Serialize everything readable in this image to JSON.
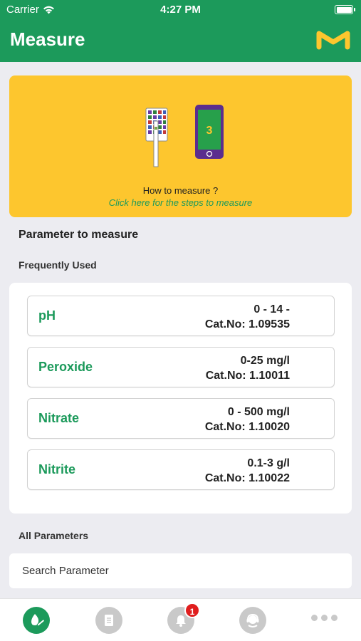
{
  "status_bar": {
    "carrier": "Carrier",
    "time": "4:27 PM"
  },
  "header": {
    "title": "Measure",
    "logo_icon": "merck-m-logo"
  },
  "banner": {
    "title": "How to measure ?",
    "link": "Click here for the steps to measure",
    "phone_number": "3",
    "background": "#fdc62e"
  },
  "section": {
    "title": "Parameter to measure",
    "frequently_used": "Frequently Used",
    "all_parameters": "All Parameters"
  },
  "frequent": [
    {
      "name": "pH",
      "range": "0 - 14 -",
      "cat": "Cat.No: 1.09535"
    },
    {
      "name": "Peroxide",
      "range": "0-25 mg/l",
      "cat": "Cat.No: 1.10011"
    },
    {
      "name": "Nitrate",
      "range": "0 - 500 mg/l",
      "cat": "Cat.No: 1.10020"
    },
    {
      "name": "Nitrite",
      "range": "0.1-3 g/l",
      "cat": "Cat.No: 1.10022"
    }
  ],
  "search": {
    "placeholder": "Search Parameter"
  },
  "tabs": {
    "notifications_badge": "1",
    "items": [
      "measure-tab-icon",
      "reports-tab-icon",
      "notifications-tab-icon",
      "support-tab-icon",
      "more-tab-icon"
    ]
  },
  "colors": {
    "brand_green": "#1c9a5b",
    "accent_yellow": "#fdc62e",
    "badge_red": "#e01e1e"
  }
}
